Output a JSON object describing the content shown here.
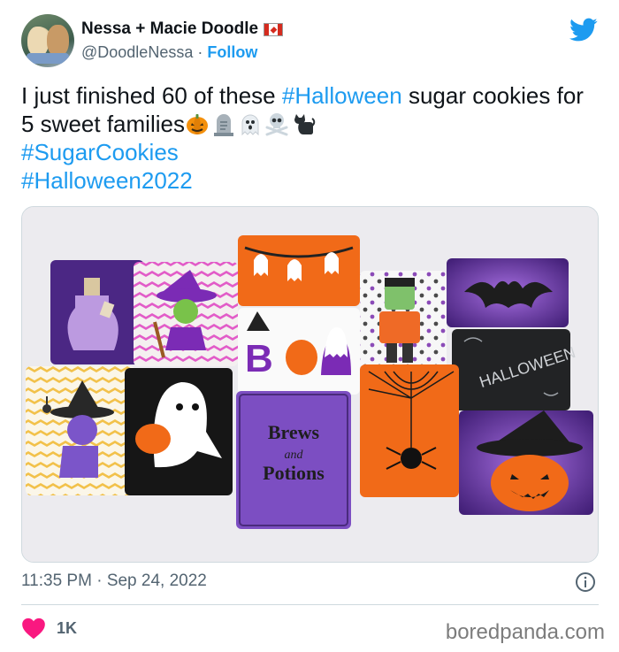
{
  "tweet": {
    "display_name": "Nessa + Macie Doodle",
    "handle": "@DoodleNessa",
    "separator": "·",
    "follow_label": "Follow",
    "text_part1": "I just finished 60 of these ",
    "hashtag_halloween": "#Halloween",
    "text_part2": " sugar cookies for 5 sweet families",
    "hashtag_sugarcookies": "#SugarCookies",
    "hashtag_halloween2022": "#Halloween2022",
    "emojis": [
      "pumpkin-icon",
      "headstone-icon",
      "ghost-icon",
      "skull-crossbones-icon",
      "black-cat-icon"
    ],
    "time": "11:35 PM",
    "date_separator": "·",
    "date": "Sep 24, 2022",
    "like_count": "1K",
    "watermark": "boredpanda.com",
    "photo_text": {
      "brews": "Brews",
      "and": "and",
      "potions": "Potions",
      "chalk": "HALLOWEEN"
    }
  },
  "colors": {
    "link": "#1d9bf0",
    "text": "#0f1419",
    "secondary": "#536471",
    "like": "#f91880"
  }
}
